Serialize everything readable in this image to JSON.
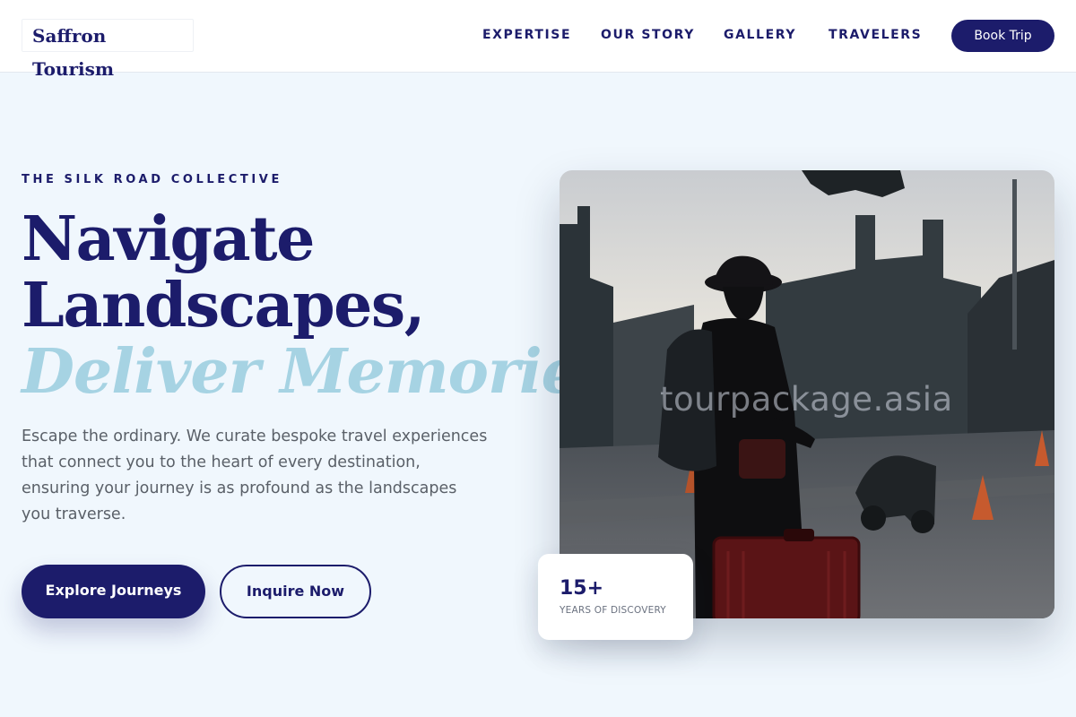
{
  "header": {
    "brand": "Saffron Tourism",
    "nav": [
      "EXPERTISE",
      "OUR STORY",
      "GALLERY",
      "TRAVELERS"
    ],
    "cta": "Book Trip"
  },
  "hero": {
    "eyebrow": "THE SILK ROAD COLLECTIVE",
    "title_line1": "Navigate",
    "title_line2": "Landscapes,",
    "title_line3": "Deliver Memories.",
    "description": "Escape the ordinary. We curate bespoke travel experiences that connect you to the heart of every destination, ensuring your journey is as profound as the landscapes you traverse.",
    "primary_button": "Explore Journeys",
    "secondary_button": "Inquire Now"
  },
  "media": {
    "watermark": "tourpackage.asia",
    "stat_value": "15+",
    "stat_label": "YEARS OF DISCOVERY"
  },
  "colors": {
    "navy": "#1c1c6b",
    "accent_light_blue": "#a6d3e3",
    "page_background": "#f0f7fd",
    "text_muted": "#5a6068"
  }
}
